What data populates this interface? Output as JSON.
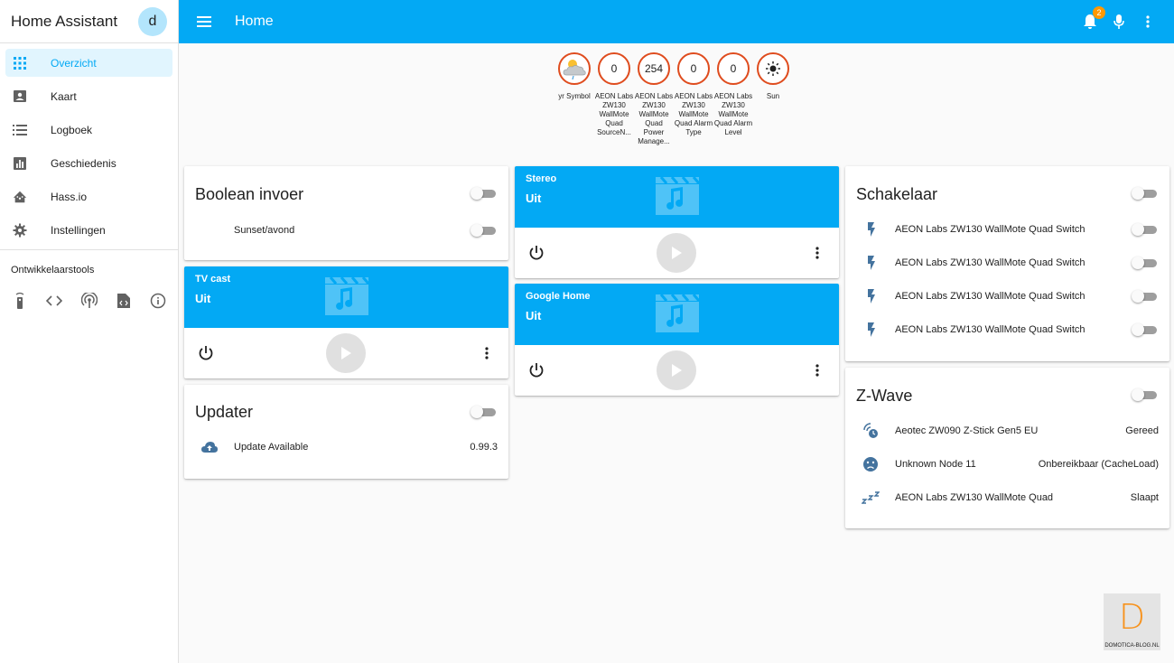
{
  "sidebar": {
    "title": "Home Assistant",
    "avatar": "d",
    "items": [
      {
        "label": "Overzicht",
        "icon": "grid-icon"
      },
      {
        "label": "Kaart",
        "icon": "map-account-icon"
      },
      {
        "label": "Logboek",
        "icon": "list-icon"
      },
      {
        "label": "Geschiedenis",
        "icon": "chart-icon"
      },
      {
        "label": "Hass.io",
        "icon": "home-assistant-icon"
      },
      {
        "label": "Instellingen",
        "icon": "cog-icon"
      }
    ],
    "dev_title": "Ontwikkelaarstools",
    "dev_tools": [
      "remote-icon",
      "code-icon",
      "antenna-icon",
      "file-code-icon",
      "info-icon"
    ]
  },
  "topbar": {
    "title": "Home",
    "notification_count": "2"
  },
  "badges": [
    {
      "value": "",
      "label": "yr Symbol",
      "icon": "weather-icon"
    },
    {
      "value": "0",
      "label": "AEON Labs ZW130 WallMote Quad SourceN..."
    },
    {
      "value": "254",
      "label": "AEON Labs ZW130 WallMote Quad Power Manage..."
    },
    {
      "value": "0",
      "label": "AEON Labs ZW130 WallMote Quad Alarm Type"
    },
    {
      "value": "0",
      "label": "AEON Labs ZW130 WallMote Quad Alarm Level"
    },
    {
      "value": "",
      "label": "Sun",
      "icon": "sun-icon"
    }
  ],
  "boolean_card": {
    "title": "Boolean invoer",
    "rows": [
      {
        "label": "Sunset/avond"
      }
    ]
  },
  "media": {
    "tv": {
      "name": "TV cast",
      "state": "Uit"
    },
    "stereo": {
      "name": "Stereo",
      "state": "Uit"
    },
    "google": {
      "name": "Google Home",
      "state": "Uit"
    }
  },
  "updater_card": {
    "title": "Updater",
    "rows": [
      {
        "label": "Update Available",
        "value": "0.99.3"
      }
    ]
  },
  "switch_card": {
    "title": "Schakelaar",
    "rows": [
      {
        "label": "AEON Labs ZW130 WallMote Quad Switch"
      },
      {
        "label": "AEON Labs ZW130 WallMote Quad Switch"
      },
      {
        "label": "AEON Labs ZW130 WallMote Quad Switch"
      },
      {
        "label": "AEON Labs ZW130 WallMote Quad Switch"
      }
    ]
  },
  "zwave_card": {
    "title": "Z-Wave",
    "rows": [
      {
        "label": "Aeotec ZW090 Z-Stick Gen5 EU",
        "value": "Gereed"
      },
      {
        "label": "Unknown Node 11",
        "value": "Onbereikbaar (CacheLoad)"
      },
      {
        "label": "AEON Labs ZW130 WallMote Quad",
        "value": "Slaapt"
      }
    ]
  },
  "watermark": {
    "letter": "D",
    "text": "DOMOTICA-BLOG.NL"
  },
  "colors": {
    "primary": "#03a9f4",
    "badge_border": "#df4c1e",
    "icon": "#44739e",
    "watermark": "#f7931e"
  }
}
